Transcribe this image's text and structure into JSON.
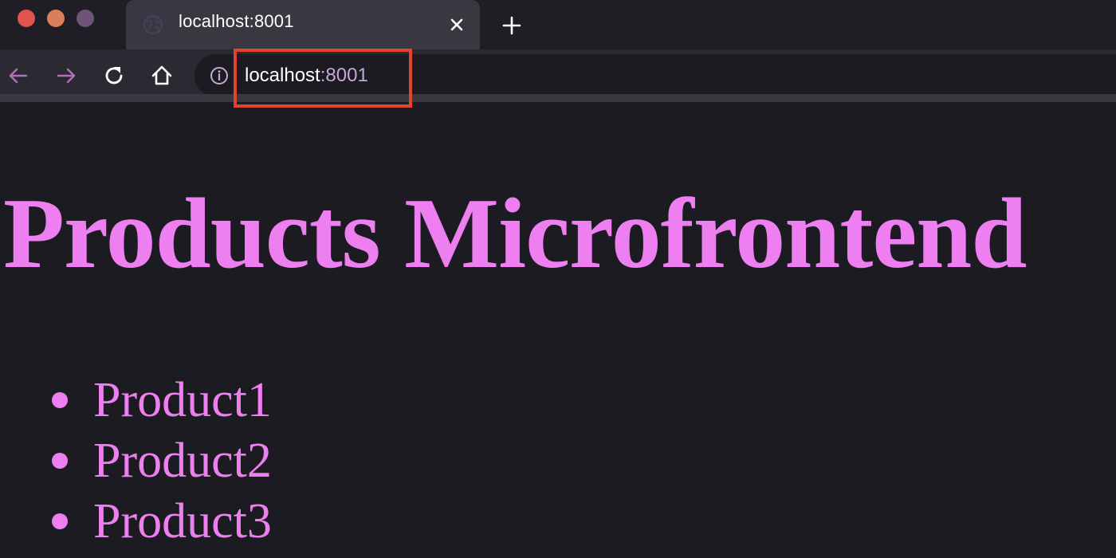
{
  "window": {
    "traffic_lights": [
      "close",
      "minimize",
      "maximize"
    ]
  },
  "tab": {
    "title": "localhost:8001",
    "favicon": "globe-icon",
    "close_icon": "close-icon"
  },
  "new_tab_icon": "plus-icon",
  "toolbar": {
    "back_icon": "back-arrow-icon",
    "forward_icon": "forward-arrow-icon",
    "reload_icon": "reload-icon",
    "home_icon": "home-icon",
    "site_info_icon": "info-icon"
  },
  "url": {
    "host": "localhost",
    "port": ":8001"
  },
  "page": {
    "heading": "Products Microfrontend",
    "products": [
      {
        "label": "Product1"
      },
      {
        "label": "Product2"
      },
      {
        "label": "Product3"
      }
    ]
  },
  "colors": {
    "accent_pink": "#ee7ff0",
    "highlight_red": "#e1442e",
    "page_background": "#1c1b22",
    "toolbar_background": "#2b2a33"
  }
}
